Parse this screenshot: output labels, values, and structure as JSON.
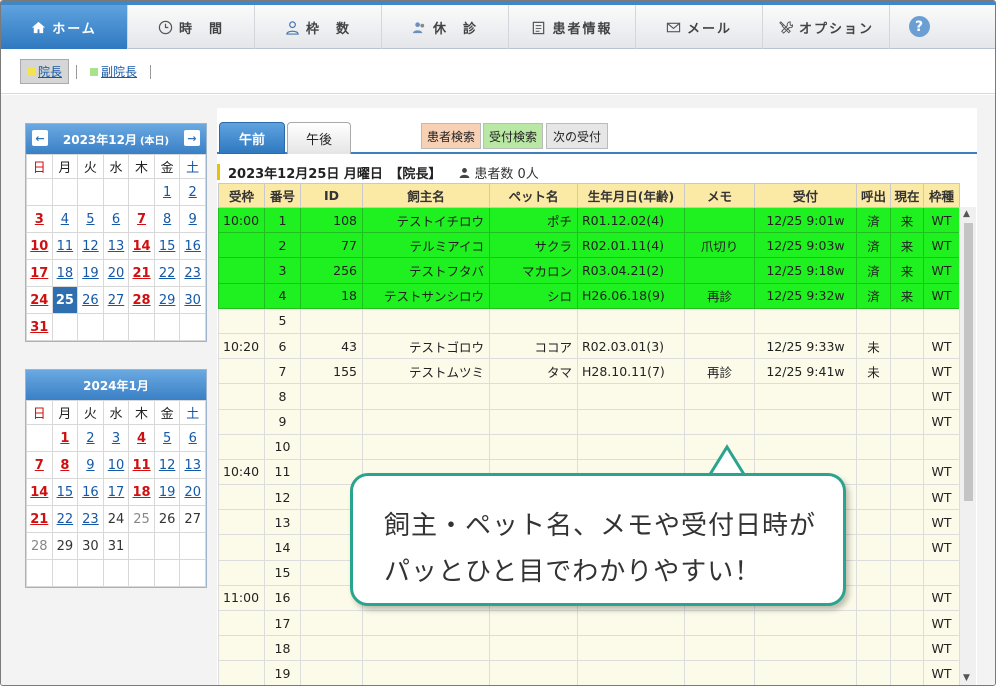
{
  "nav": [
    {
      "label": "ホーム",
      "icon": "home-icon"
    },
    {
      "label": "時　間",
      "icon": "clock-icon"
    },
    {
      "label": "枠　数",
      "icon": "person-icon"
    },
    {
      "label": "休　診",
      "icon": "people-icon"
    },
    {
      "label": "患者情報",
      "icon": "clipboard-icon"
    },
    {
      "label": "メール",
      "icon": "mail-icon"
    },
    {
      "label": "オプション",
      "icon": "tools-icon"
    }
  ],
  "help": "?",
  "doctors": [
    "院長",
    "副院長"
  ],
  "cal1": {
    "title": "2023年12月",
    "today_label": "(本日)",
    "prev": "←",
    "next": "→"
  },
  "cal2": {
    "title": "2024年1月"
  },
  "weekdays": [
    "日",
    "月",
    "火",
    "水",
    "木",
    "金",
    "土"
  ],
  "tabs": {
    "am": "午前",
    "pm": "午後"
  },
  "buttons": {
    "patient_search": "患者検索",
    "reception_search": "受付検索",
    "next_reception": "次の受付"
  },
  "info": {
    "date": "2023年12月25日 月曜日　【院長】",
    "patients": "患者数 0人"
  },
  "columns": [
    "受枠",
    "番号",
    "ID",
    "飼主名",
    "ペット名",
    "生年月日(年齢)",
    "メモ",
    "受付",
    "呼出",
    "現在",
    "枠種"
  ],
  "rows": [
    {
      "slot": "10:00",
      "no": "1",
      "id": "108",
      "owner": "テストイチロウ",
      "pet": "ポチ",
      "dob": "R01.12.02(4)",
      "memo": "",
      "recv": "12/25 9:01w",
      "call": "済",
      "now": "来",
      "type": "WT"
    },
    {
      "slot": "",
      "no": "2",
      "id": "77",
      "owner": "テルミアイコ",
      "pet": "サクラ",
      "dob": "R02.01.11(4)",
      "memo": "爪切り",
      "recv": "12/25 9:03w",
      "call": "済",
      "now": "来",
      "type": "WT"
    },
    {
      "slot": "",
      "no": "3",
      "id": "256",
      "owner": "テストフタバ",
      "pet": "マカロン",
      "dob": "R03.04.21(2)",
      "memo": "",
      "recv": "12/25 9:18w",
      "call": "済",
      "now": "来",
      "type": "WT"
    },
    {
      "slot": "",
      "no": "4",
      "id": "18",
      "owner": "テストサンシロウ",
      "pet": "シロ",
      "dob": "H26.06.18(9)",
      "memo": "再診",
      "recv": "12/25 9:32w",
      "call": "済",
      "now": "来",
      "type": "WT"
    },
    {
      "slot": "",
      "no": "5",
      "id": "",
      "owner": "",
      "pet": "",
      "dob": "",
      "memo": "",
      "recv": "",
      "call": "",
      "now": "",
      "type": ""
    },
    {
      "slot": "10:20",
      "no": "6",
      "id": "43",
      "owner": "テストゴロウ",
      "pet": "ココア",
      "dob": "R02.03.01(3)",
      "memo": "",
      "recv": "12/25 9:33w",
      "call": "未",
      "now": "",
      "type": "WT"
    },
    {
      "slot": "",
      "no": "7",
      "id": "155",
      "owner": "テストムツミ",
      "pet": "タマ",
      "dob": "H28.10.11(7)",
      "memo": "再診",
      "recv": "12/25 9:41w",
      "call": "未",
      "now": "",
      "type": "WT"
    },
    {
      "slot": "",
      "no": "8",
      "id": "",
      "owner": "",
      "pet": "",
      "dob": "",
      "memo": "",
      "recv": "",
      "call": "",
      "now": "",
      "type": "WT"
    },
    {
      "slot": "",
      "no": "9",
      "id": "",
      "owner": "",
      "pet": "",
      "dob": "",
      "memo": "",
      "recv": "",
      "call": "",
      "now": "",
      "type": "WT"
    },
    {
      "slot": "",
      "no": "10",
      "id": "",
      "owner": "",
      "pet": "",
      "dob": "",
      "memo": "",
      "recv": "",
      "call": "",
      "now": "",
      "type": ""
    },
    {
      "slot": "10:40",
      "no": "11",
      "id": "",
      "owner": "",
      "pet": "",
      "dob": "",
      "memo": "",
      "recv": "",
      "call": "",
      "now": "",
      "type": "WT"
    },
    {
      "slot": "",
      "no": "12",
      "id": "",
      "owner": "",
      "pet": "",
      "dob": "",
      "memo": "",
      "recv": "",
      "call": "",
      "now": "",
      "type": "WT"
    },
    {
      "slot": "",
      "no": "13",
      "id": "",
      "owner": "",
      "pet": "",
      "dob": "",
      "memo": "",
      "recv": "",
      "call": "",
      "now": "",
      "type": "WT"
    },
    {
      "slot": "",
      "no": "14",
      "id": "",
      "owner": "",
      "pet": "",
      "dob": "",
      "memo": "",
      "recv": "",
      "call": "",
      "now": "",
      "type": "WT"
    },
    {
      "slot": "",
      "no": "15",
      "id": "",
      "owner": "",
      "pet": "",
      "dob": "",
      "memo": "",
      "recv": "",
      "call": "",
      "now": "",
      "type": ""
    },
    {
      "slot": "11:00",
      "no": "16",
      "id": "",
      "owner": "",
      "pet": "",
      "dob": "",
      "memo": "",
      "recv": "",
      "call": "",
      "now": "",
      "type": "WT"
    },
    {
      "slot": "",
      "no": "17",
      "id": "",
      "owner": "",
      "pet": "",
      "dob": "",
      "memo": "",
      "recv": "",
      "call": "",
      "now": "",
      "type": "WT"
    },
    {
      "slot": "",
      "no": "18",
      "id": "",
      "owner": "",
      "pet": "",
      "dob": "",
      "memo": "",
      "recv": "",
      "call": "",
      "now": "",
      "type": "WT"
    },
    {
      "slot": "",
      "no": "19",
      "id": "",
      "owner": "",
      "pet": "",
      "dob": "",
      "memo": "",
      "recv": "",
      "call": "",
      "now": "",
      "type": "WT"
    }
  ],
  "callout": {
    "line1": "飼主・ペット名、メモや受付日時が",
    "line2": "パッとひと目でわかりやすい！"
  },
  "colors": {
    "nav_active": "#3e87c8",
    "arrived_row": "#1ff01f",
    "header_bg": "#fbe9a6",
    "callout_border": "#2aa48e"
  }
}
